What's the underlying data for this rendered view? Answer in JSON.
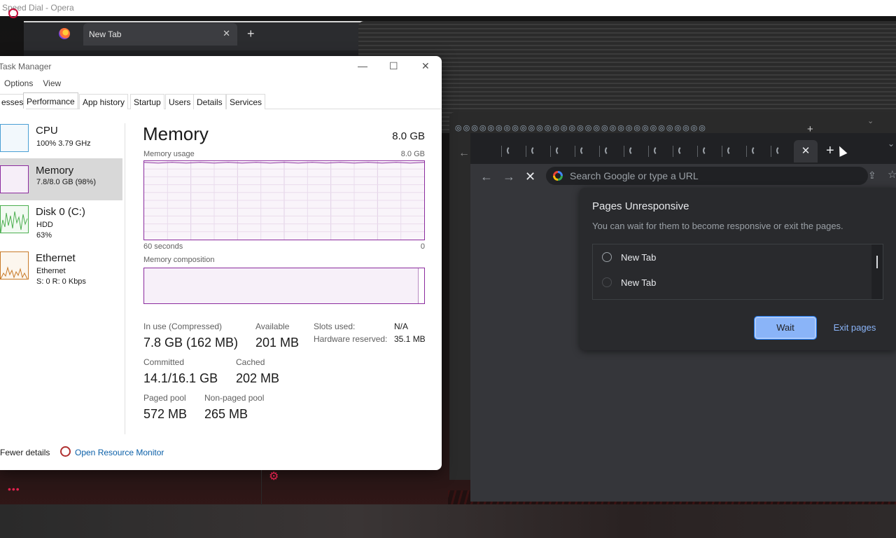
{
  "opera": {
    "window_title": "Speed Dial - Opera",
    "tab_label": "New Tab",
    "tab_close": "✕",
    "new_tab": "+"
  },
  "task_manager": {
    "title": "Task Manager",
    "menu": [
      "Options",
      "View"
    ],
    "tabs": [
      "esses",
      "Performance",
      "App history",
      "Startup",
      "Users",
      "Details",
      "Services"
    ],
    "resources": [
      {
        "name": "CPU",
        "line1": "100%  3.79 GHz",
        "line2": ""
      },
      {
        "name": "Memory",
        "line1": "7.8/8.0 GB (98%)",
        "line2": ""
      },
      {
        "name": "Disk 0 (C:)",
        "line1": "HDD",
        "line2": "63%"
      },
      {
        "name": "Ethernet",
        "line1": "Ethernet",
        "line2": "S: 0 R: 0 Kbps"
      }
    ],
    "memory": {
      "title": "Memory",
      "total": "8.0 GB",
      "usage_label": "Memory usage",
      "usage_max": "8.0 GB",
      "time_left": "60 seconds",
      "time_right": "0",
      "composition_label": "Memory composition",
      "in_use_label": "In use (Compressed)",
      "in_use_value": "7.8 GB (162 MB)",
      "available_label": "Available",
      "available_value": "201 MB",
      "slots_label": "Slots used:",
      "slots_value": "N/A",
      "hw_reserved_label": "Hardware reserved:",
      "hw_reserved_value": "35.1 MB",
      "committed_label": "Committed",
      "committed_value": "14.1/16.1 GB",
      "cached_label": "Cached",
      "cached_value": "202 MB",
      "paged_label": "Paged pool",
      "paged_value": "572 MB",
      "nonpaged_label": "Non-paged pool",
      "nonpaged_value": "265 MB",
      "usage_fraction": 0.98
    },
    "footer": {
      "fewer_details": "Fewer details",
      "open_rm": "Open Resource Monitor"
    }
  },
  "chrome": {
    "omnibox_placeholder": "Search Google or type a URL",
    "tab_close": "✕",
    "new_tab": "+"
  },
  "dialog": {
    "title": "Pages Unresponsive",
    "description": "You can wait for them to become responsive or exit the pages.",
    "pages": [
      "New Tab",
      "New Tab"
    ],
    "wait_label": "Wait",
    "exit_label": "Exit pages"
  },
  "colors": {
    "memory_accent": "#8b2b9e",
    "cpu_accent": "#4a9fd4",
    "disk_accent": "#4caf50",
    "ethernet_accent": "#c87a28",
    "chrome_blue": "#8ab4f8"
  }
}
